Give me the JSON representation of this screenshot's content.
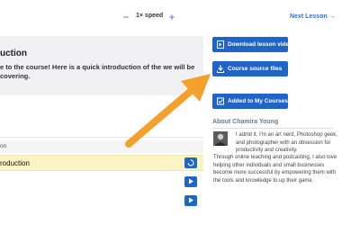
{
  "player": {
    "speed_label": "1× speed",
    "minus_label": "−",
    "plus_label": "+",
    "next_lesson": "Next Lesson →"
  },
  "lesson": {
    "title": "uction",
    "description": "e to the course! Here is a quick introduction of the we will be covering."
  },
  "lesson_list": {
    "header": "on",
    "active_item": "roduction"
  },
  "actions": {
    "download_video": "Download lesson video",
    "course_files": "Course source files",
    "add_to_courses": "Added to My Courses"
  },
  "about": {
    "title": "About Chamira Young",
    "bio_part1": "I admit it, I'm an art nerd, Photoshop geek, and photographer with an obsession for productivity and creativity.",
    "bio_part2": "Through online teaching and podcasting, I also love helping other individuals and small businesses become more successful by empowering them with the tools and knowledge to up their game."
  },
  "colors": {
    "accent": "#2164c8",
    "arrow": "#f5a02a",
    "highlight": "#fcf3c5"
  }
}
